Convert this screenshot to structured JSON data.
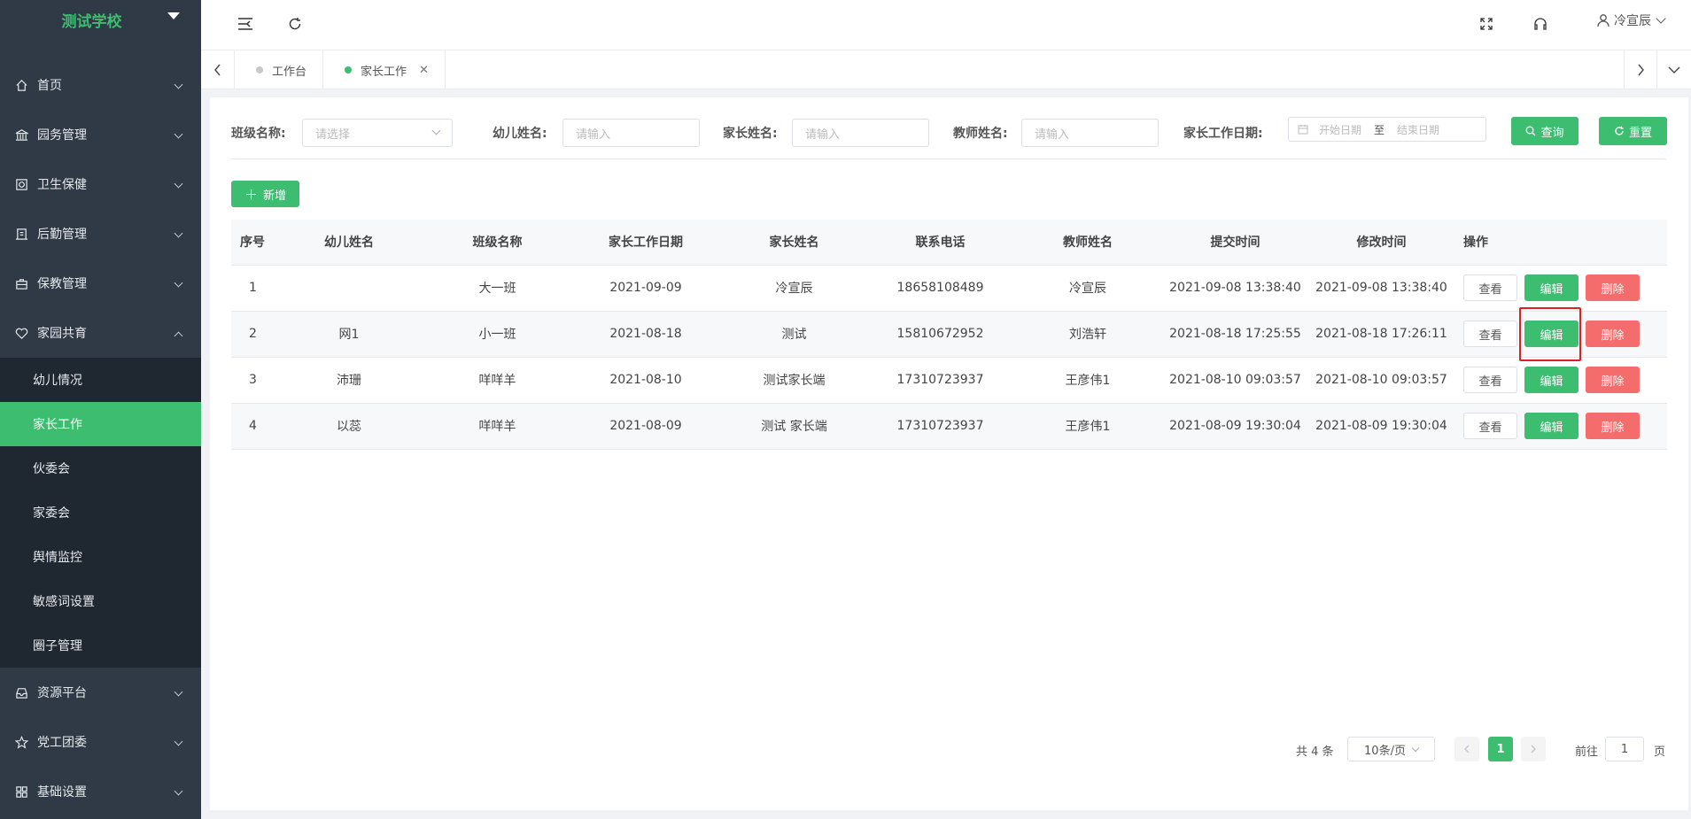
{
  "sidebar": {
    "logo": "测试学校",
    "menu": [
      {
        "label": "首页"
      },
      {
        "label": "园务管理"
      },
      {
        "label": "卫生保健"
      },
      {
        "label": "后勤管理"
      },
      {
        "label": "保教管理"
      },
      {
        "label": "家园共育"
      }
    ],
    "submenu": [
      {
        "label": "幼儿情况"
      },
      {
        "label": "家长工作"
      },
      {
        "label": "伙委会"
      },
      {
        "label": "家委会"
      },
      {
        "label": "舆情监控"
      },
      {
        "label": "敏感词设置"
      },
      {
        "label": "圈子管理"
      }
    ],
    "menu_after": [
      {
        "label": "资源平台"
      },
      {
        "label": "党工团委"
      },
      {
        "label": "基础设置"
      }
    ]
  },
  "header": {
    "username": "冷宣辰"
  },
  "tabs": [
    {
      "label": "工作台",
      "dot_color": "#c8c9cc"
    },
    {
      "label": "家长工作",
      "dot_color": "#3dbd6f"
    }
  ],
  "filters": {
    "class_label": "班级名称:",
    "class_placeholder": "请选择",
    "child_label": "幼儿姓名:",
    "child_placeholder": "请输入",
    "parent_label": "家长姓名:",
    "parent_placeholder": "请输入",
    "teacher_label": "教师姓名:",
    "teacher_placeholder": "请输入",
    "date_label": "家长工作日期:",
    "start_placeholder": "开始日期",
    "date_sep": "至",
    "end_placeholder": "结束日期",
    "query_label": "查询",
    "reset_label": "重置"
  },
  "add_label": "新增",
  "table": {
    "headers": [
      "序号",
      "幼儿姓名",
      "班级名称",
      "家长工作日期",
      "家长姓名",
      "联系电话",
      "教师姓名",
      "提交时间",
      "修改时间",
      "操作"
    ],
    "rows": [
      [
        "1",
        "",
        "大一班",
        "2021-09-09",
        "冷宣辰",
        "18658108489",
        "冷宣辰",
        "2021-09-08 13:38:40",
        "2021-09-08 13:38:40"
      ],
      [
        "2",
        "网1",
        "小一班",
        "2021-08-18",
        "测试",
        "15810672952",
        "刘浩轩",
        "2021-08-18 17:25:55",
        "2021-08-18 17:26:11"
      ],
      [
        "3",
        "沛珊",
        "咩咩羊",
        "2021-08-10",
        "测试家长端",
        "17310723937",
        "王彦伟1",
        "2021-08-10 09:03:57",
        "2021-08-10 09:03:57"
      ],
      [
        "4",
        "以蕊",
        "咩咩羊",
        "2021-08-09",
        "测试 家长端",
        "17310723937",
        "王彦伟1",
        "2021-08-09 19:30:04",
        "2021-08-09 19:30:04"
      ]
    ],
    "view_label": "查看",
    "edit_label": "编辑",
    "delete_label": "删除"
  },
  "pagination": {
    "total": "共 4 条",
    "page_size": "10条/页",
    "current": "1",
    "goto_prefix": "前往",
    "goto_value": "1",
    "goto_suffix": "页"
  },
  "colors": {
    "accent": "#3dbd6f",
    "danger": "#f56c6c",
    "sidebar_bg": "#2f3a46",
    "submenu_bg": "#1f2731"
  }
}
